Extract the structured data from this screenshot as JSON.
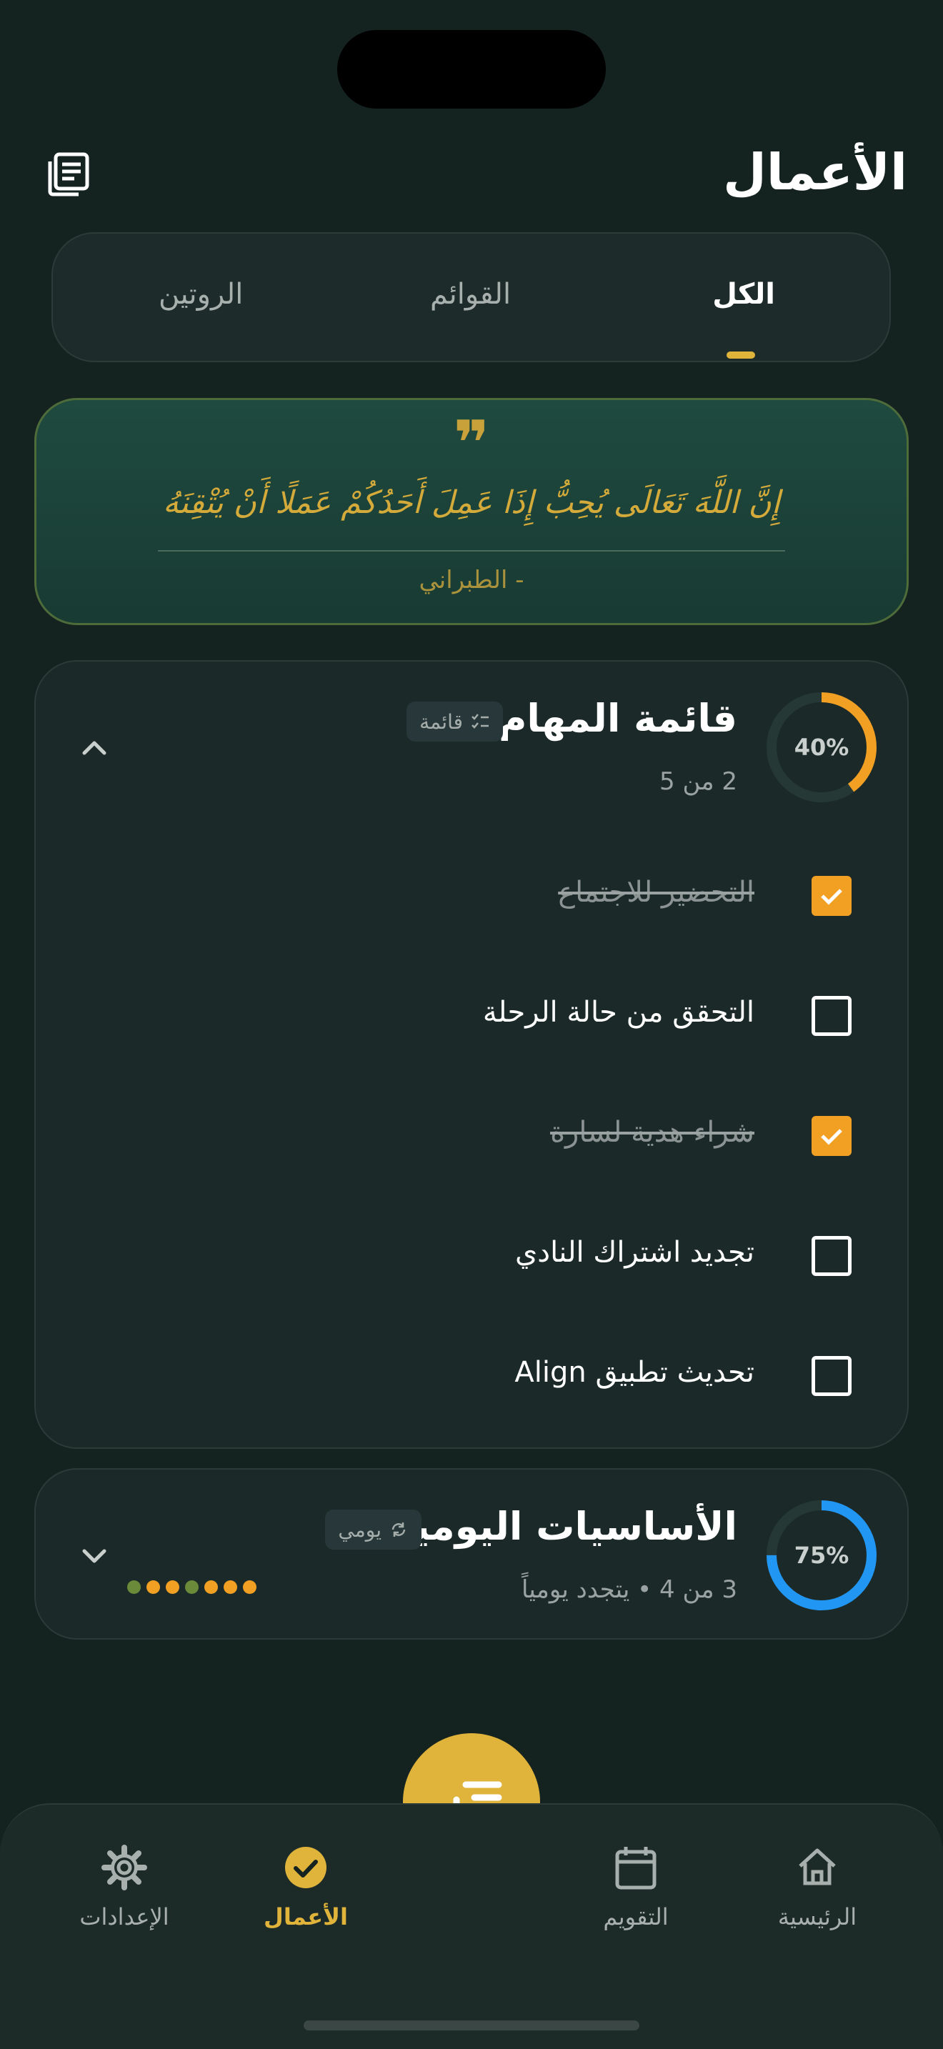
{
  "header": {
    "title": "الأعمال",
    "doc_icon": "notes-icon"
  },
  "tabs": [
    {
      "label": "الكل",
      "active": true
    },
    {
      "label": "القوائم",
      "active": false
    },
    {
      "label": "الروتين",
      "active": false
    }
  ],
  "quote": {
    "mark": "❞",
    "text": "إِنَّ اللَّهَ تَعَالَى يُحِبُّ إِذَا عَمِلَ أَحَدُكُمْ عَمَلًا أَنْ يُتْقِنَهُ",
    "source": "- الطبراني"
  },
  "task_list": {
    "progress_label": "40%",
    "progress": 0.4,
    "title": "قائمة المهام",
    "badge": "قائمة",
    "count": "2 من 5",
    "expanded": true,
    "items": [
      {
        "label": "التحضير للاجتماع",
        "done": true
      },
      {
        "label": "التحقق من حالة الرحلة",
        "done": false
      },
      {
        "label": "شراء هدية لسارة",
        "done": true
      },
      {
        "label": "تجديد اشتراك النادي",
        "done": false
      },
      {
        "label": "تحديث تطبيق Align",
        "done": false
      }
    ]
  },
  "daily": {
    "progress_label": "75%",
    "progress": 0.75,
    "title": "الأساسيات اليومية",
    "badge": "يومي",
    "subtitle": "3 من 4 • يتجدد يومياً",
    "expanded": false,
    "dots": [
      "#f2a024",
      "#f2a024",
      "#f2a024",
      "#6b8a3a",
      "#f2a024",
      "#f2a024",
      "#6b8a3a"
    ]
  },
  "nav": {
    "home": "الرئيسية",
    "calendar": "التقويم",
    "tasks": "الأعمال",
    "settings": "الإعدادات",
    "active": "tasks"
  },
  "colors": {
    "accent": "#e0b33b",
    "orange": "#f2a024",
    "blue": "#2196f3",
    "background": "#142220"
  }
}
